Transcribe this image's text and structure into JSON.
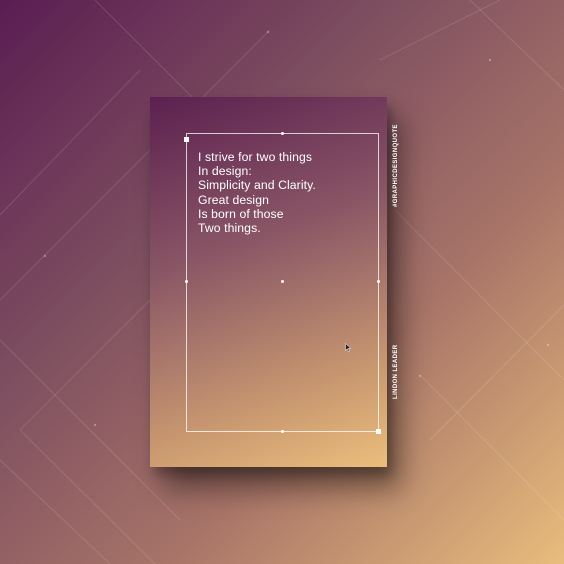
{
  "poster": {
    "quote_lines": [
      "I strive for two things",
      "In design:",
      "Simplicity and Clarity.",
      "Great design",
      "Is born of those",
      "Two things."
    ],
    "hashtag": "#GRAPHICDESIGNQUOTE",
    "author": "LINDON LEADER"
  },
  "colors": {
    "background_top": "#5a1d52",
    "background_bottom": "#e8bd7c",
    "poster_top": "#5c2050",
    "poster_bottom": "#ebbe7c",
    "text": "#ffffff"
  },
  "icons": [
    "mouse-cursor-icon"
  ]
}
